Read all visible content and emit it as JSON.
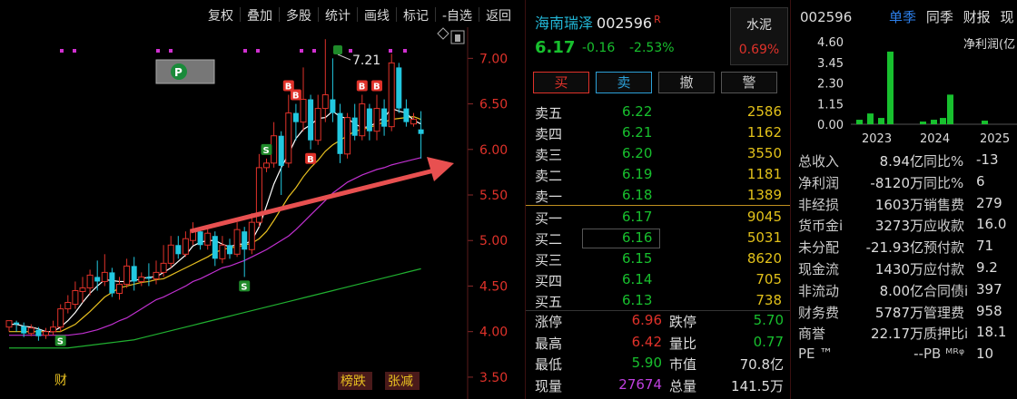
{
  "toolbar": {
    "items": [
      "复权",
      "叠加",
      "多股",
      "统计",
      "画线",
      "标记",
      "-自选",
      "返回"
    ]
  },
  "chart": {
    "y_ticks": [
      "7.00",
      "6.50",
      "6.00",
      "5.50",
      "5.00",
      "4.50",
      "4.00",
      "3.50"
    ],
    "high_marker": "7.21",
    "bottom_labels": {
      "cai": "财",
      "bangdie": "榜跌",
      "zhangjian": "张减"
    },
    "colors": {
      "up": "#e0322a",
      "down": "#22c8e0",
      "ma5": "#ffffff",
      "ma10": "#e8c020",
      "ma20": "#c030d0",
      "ma60": "#20b030",
      "arrow": "#e85050"
    }
  },
  "chart_data": {
    "type": "candlestick",
    "ylim": [
      3.3,
      7.3
    ],
    "y_ticks": [
      7.0,
      6.5,
      6.0,
      5.5,
      5.0,
      4.5,
      4.0,
      3.5
    ],
    "candles": [
      [
        4.05,
        4.12,
        4.0,
        4.1
      ],
      [
        4.1,
        4.08,
        4.0,
        4.12
      ],
      [
        4.06,
        3.98,
        3.94,
        4.1
      ],
      [
        3.98,
        4.04,
        3.95,
        4.08
      ],
      [
        4.02,
        3.95,
        3.9,
        4.05
      ],
      [
        3.96,
        4.0,
        3.92,
        4.04
      ],
      [
        4.0,
        4.05,
        3.96,
        4.12
      ],
      [
        4.05,
        4.25,
        4.0,
        4.3
      ],
      [
        4.25,
        4.32,
        4.2,
        4.4
      ],
      [
        4.3,
        4.45,
        4.25,
        4.55
      ],
      [
        4.44,
        4.48,
        4.32,
        4.6
      ],
      [
        4.48,
        4.62,
        4.4,
        4.68
      ],
      [
        4.6,
        4.55,
        4.45,
        4.78
      ],
      [
        4.55,
        4.65,
        4.5,
        4.85
      ],
      [
        4.65,
        4.42,
        4.38,
        4.7
      ],
      [
        4.42,
        4.52,
        4.35,
        4.6
      ],
      [
        4.52,
        4.72,
        4.48,
        4.8
      ],
      [
        4.72,
        4.55,
        4.45,
        4.82
      ],
      [
        4.55,
        4.6,
        4.5,
        4.65
      ],
      [
        4.6,
        4.58,
        4.5,
        4.75
      ],
      [
        4.58,
        4.65,
        4.52,
        4.78
      ],
      [
        4.65,
        4.75,
        4.6,
        4.95
      ],
      [
        4.75,
        4.95,
        4.7,
        5.05
      ],
      [
        4.95,
        4.85,
        4.8,
        5.05
      ],
      [
        4.85,
        5.02,
        4.82,
        5.1
      ],
      [
        5.0,
        5.12,
        4.95,
        5.2
      ],
      [
        5.1,
        4.95,
        4.9,
        5.15
      ],
      [
        4.95,
        5.08,
        4.9,
        5.15
      ],
      [
        5.05,
        4.8,
        4.72,
        5.1
      ],
      [
        4.8,
        4.95,
        4.75,
        5.05
      ],
      [
        4.95,
        4.85,
        4.8,
        5.02
      ],
      [
        4.85,
        5.12,
        4.82,
        5.2
      ],
      [
        5.1,
        4.9,
        4.6,
        5.15
      ],
      [
        4.9,
        5.2,
        4.85,
        5.3
      ],
      [
        5.2,
        5.8,
        5.15,
        5.95
      ],
      [
        5.8,
        5.85,
        5.75,
        5.9
      ],
      [
        5.85,
        6.15,
        5.8,
        6.3
      ],
      [
        6.15,
        5.82,
        5.5,
        6.2
      ],
      [
        5.85,
        6.4,
        5.8,
        6.6
      ],
      [
        6.4,
        6.3,
        6.1,
        6.5
      ],
      [
        6.3,
        6.55,
        6.2,
        6.9
      ],
      [
        6.55,
        6.1,
        6.0,
        6.6
      ],
      [
        6.1,
        6.45,
        6.05,
        6.6
      ],
      [
        6.45,
        6.6,
        6.3,
        7.21
      ],
      [
        6.55,
        6.4,
        6.3,
        7.0
      ],
      [
        6.4,
        5.95,
        5.85,
        6.5
      ],
      [
        5.95,
        6.35,
        5.9,
        6.4
      ],
      [
        6.35,
        6.15,
        6.1,
        6.5
      ],
      [
        6.15,
        6.5,
        6.1,
        6.6
      ],
      [
        6.45,
        6.2,
        6.1,
        6.5
      ],
      [
        6.2,
        6.45,
        6.1,
        6.6
      ],
      [
        6.45,
        6.25,
        6.15,
        6.55
      ],
      [
        6.25,
        6.95,
        6.2,
        7.05
      ],
      [
        6.9,
        6.45,
        6.4,
        6.95
      ],
      [
        6.45,
        6.3,
        6.25,
        6.55
      ],
      [
        6.28,
        6.33,
        6.25,
        6.4
      ],
      [
        6.22,
        6.17,
        5.9,
        6.42
      ]
    ],
    "ma5": [
      4.08,
      4.08,
      4.06,
      4.05,
      4.03,
      4.0,
      4.0,
      4.05,
      4.12,
      4.21,
      4.32,
      4.42,
      4.5,
      4.57,
      4.56,
      4.55,
      4.55,
      4.56,
      4.58,
      4.6,
      4.6,
      4.65,
      4.7,
      4.77,
      4.84,
      4.94,
      4.98,
      5.0,
      5.0,
      4.96,
      4.93,
      4.96,
      4.96,
      5.0,
      5.15,
      5.38,
      5.62,
      5.8,
      5.95,
      6.12,
      6.22,
      6.27,
      6.34,
      6.35,
      6.42,
      6.36,
      6.34,
      6.28,
      6.24,
      6.25,
      6.3,
      6.35,
      6.45,
      6.42,
      6.4,
      6.32,
      6.28
    ],
    "ma10": [
      4.0,
      4.0,
      4.0,
      4.0,
      4.0,
      4.0,
      4.0,
      4.0,
      4.04,
      4.08,
      4.15,
      4.22,
      4.3,
      4.38,
      4.43,
      4.48,
      4.5,
      4.52,
      4.54,
      4.55,
      4.57,
      4.58,
      4.62,
      4.66,
      4.7,
      4.74,
      4.78,
      4.82,
      4.87,
      4.9,
      4.92,
      4.93,
      4.95,
      4.97,
      5.02,
      5.1,
      5.22,
      5.35,
      5.48,
      5.58,
      5.7,
      5.8,
      5.88,
      5.98,
      6.05,
      6.1,
      6.15,
      6.2,
      6.22,
      6.24,
      6.27,
      6.3,
      6.33,
      6.34,
      6.35,
      6.36,
      6.33
    ],
    "ma20": [
      3.96,
      3.96,
      3.96,
      3.96,
      3.96,
      3.96,
      3.96,
      3.96,
      3.96,
      3.97,
      3.98,
      4.0,
      4.02,
      4.05,
      4.08,
      4.12,
      4.15,
      4.2,
      4.25,
      4.3,
      4.35,
      4.38,
      4.42,
      4.46,
      4.5,
      4.55,
      4.58,
      4.62,
      4.66,
      4.7,
      4.72,
      4.75,
      4.78,
      4.82,
      4.86,
      4.9,
      4.95,
      5.0,
      5.05,
      5.12,
      5.2,
      5.28,
      5.36,
      5.44,
      5.52,
      5.58,
      5.64,
      5.68,
      5.72,
      5.75,
      5.78,
      5.8,
      5.83,
      5.85,
      5.87,
      5.89,
      5.91
    ],
    "ma60": [
      3.82,
      3.82,
      3.82,
      3.82,
      3.82,
      3.82,
      3.82,
      3.82,
      3.82,
      3.83,
      3.84,
      3.85,
      3.86,
      3.87,
      3.88,
      3.89,
      3.9,
      3.91,
      3.93,
      3.95,
      3.97,
      3.99,
      4.01,
      4.03,
      4.05,
      4.07,
      4.09,
      4.11,
      4.13,
      4.15,
      4.17,
      4.19,
      4.21,
      4.23,
      4.25,
      4.27,
      4.29,
      4.31,
      4.33,
      4.35,
      4.37,
      4.39,
      4.41,
      4.43,
      4.45,
      4.47,
      4.49,
      4.51,
      4.53,
      4.55,
      4.57,
      4.59,
      4.61,
      4.63,
      4.65,
      4.67,
      4.69
    ],
    "markers": [
      {
        "i": 7,
        "type": "S",
        "where": "below"
      },
      {
        "i": 32,
        "type": "S",
        "where": "below"
      },
      {
        "i": 35,
        "type": "S",
        "where": "above"
      },
      {
        "i": 38,
        "type": "B",
        "where": "above"
      },
      {
        "i": 39,
        "type": "B",
        "where": "above"
      },
      {
        "i": 41,
        "type": "B",
        "where": "below"
      },
      {
        "i": 48,
        "type": "B",
        "where": "above"
      },
      {
        "i": 50,
        "type": "B",
        "where": "above"
      }
    ]
  },
  "quote": {
    "name": "海南瑞泽",
    "code": "002596",
    "r_mark": "R",
    "price": "6.17",
    "change": "-0.16",
    "change_pct": "-2.53%",
    "sector": {
      "name": "水泥",
      "pct": "0.69%"
    },
    "buttons": {
      "buy": "买",
      "sell": "卖",
      "cancel": "撤",
      "alert": "警"
    },
    "asks": [
      {
        "label": "卖五",
        "price": "6.22",
        "vol": "2586"
      },
      {
        "label": "卖四",
        "price": "6.21",
        "vol": "1162"
      },
      {
        "label": "卖三",
        "price": "6.20",
        "vol": "3550"
      },
      {
        "label": "卖二",
        "price": "6.19",
        "vol": "1181"
      },
      {
        "label": "卖一",
        "price": "6.18",
        "vol": "1389"
      }
    ],
    "bids": [
      {
        "label": "买一",
        "price": "6.17",
        "vol": "9045"
      },
      {
        "label": "买二",
        "price": "6.16",
        "vol": "5031"
      },
      {
        "label": "买三",
        "price": "6.15",
        "vol": "8620"
      },
      {
        "label": "买四",
        "price": "6.14",
        "vol": "705"
      },
      {
        "label": "买五",
        "price": "6.13",
        "vol": "738"
      }
    ],
    "stats": [
      {
        "l1": "涨停",
        "v1": "6.96",
        "c1": "red",
        "l2": "跌停",
        "v2": "5.70",
        "c2": "green"
      },
      {
        "l1": "最高",
        "v1": "6.42",
        "c1": "red",
        "l2": "量比",
        "v2": "0.77",
        "c2": "green"
      },
      {
        "l1": "最低",
        "v1": "5.90",
        "c1": "green",
        "l2": "市值",
        "v2": "70.8亿",
        "c2": "white"
      },
      {
        "l1": "现量",
        "v1": "27674",
        "c1": "purple",
        "l2": "总量",
        "v2": "141.5万",
        "c2": "white"
      }
    ]
  },
  "fund": {
    "code": "002596",
    "tabs": [
      "单季",
      "同季",
      "财报",
      "现"
    ],
    "metric_label": "净利润(亿",
    "y_ticks": [
      "4.60",
      "3.45",
      "2.30",
      "1.15",
      "0.00"
    ],
    "years": [
      "2023",
      "2024",
      "2025"
    ],
    "bar_values": [
      0.25,
      0.6,
      0.35,
      4.05,
      0.15,
      0.25,
      0.35,
      1.65,
      0.2
    ],
    "rows": [
      {
        "l1": "总收入",
        "v1": "8.94亿",
        "l2": "同比%",
        "v2": "-13"
      },
      {
        "l1": "净利润",
        "v1": "-8120万",
        "l2": "同比%",
        "v2": "6"
      },
      {
        "l1": "非经损",
        "v1": "1603万",
        "l2": "销售费",
        "v2": "279"
      },
      {
        "l1": "货币金i",
        "v1": "3273万",
        "l2": "应收款",
        "v2": "16.0"
      },
      {
        "l1": "未分配",
        "v1": "-21.93亿",
        "l2": "预付款",
        "v2": "71"
      },
      {
        "l1": "现金流",
        "v1": "1430万",
        "l2": "应付款",
        "v2": "9.2"
      },
      {
        "l1": "非流动",
        "v1": "8.00亿",
        "l2": "合同债i",
        "v2": "397"
      },
      {
        "l1": "财务费",
        "v1": "5787万",
        "l2": "管理费",
        "v2": "958"
      },
      {
        "l1": "商誉",
        "v1": "22.17万",
        "l2": "质押比i",
        "v2": "18.1"
      },
      {
        "l1": "PE ™",
        "v1": "--",
        "l2": "PB ᴹᴿᵠ",
        "v2": "10"
      }
    ]
  }
}
